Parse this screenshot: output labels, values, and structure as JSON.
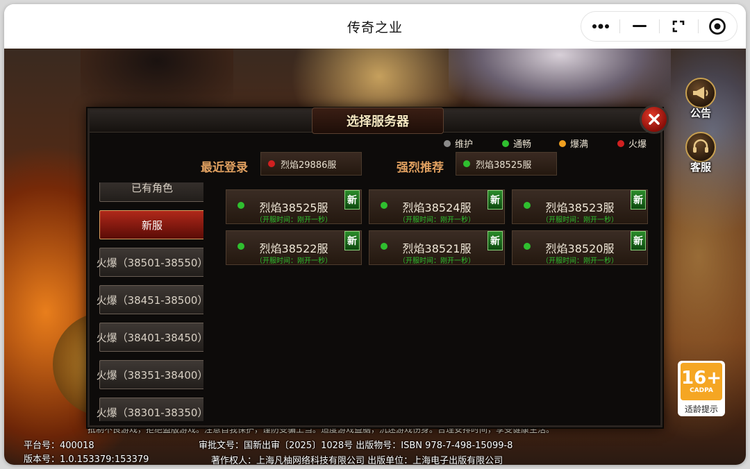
{
  "window": {
    "title": "传奇之业"
  },
  "capsule": {
    "more": "more-icon",
    "minimize": "minimize-icon",
    "fullscreen": "fullscreen-icon",
    "close": "close-circle-icon"
  },
  "side_buttons": {
    "notice": "公告",
    "service": "客服"
  },
  "age_rating": {
    "age": "16+",
    "org": "CADPA",
    "tip": "适龄提示"
  },
  "dialog": {
    "title": "选择服务器",
    "legend": [
      {
        "label": "维护",
        "color": "#8a8a8a"
      },
      {
        "label": "通畅",
        "color": "#2fbf2f"
      },
      {
        "label": "爆满",
        "color": "#f0a020"
      },
      {
        "label": "火爆",
        "color": "#d02020"
      }
    ],
    "recent_label": "最近登录",
    "recent_server": "烈焰29886服",
    "recommend_label": "强烈推荐",
    "recommend_server": "烈焰38525服",
    "categories": [
      "已有角色",
      "新服",
      "火爆（38501-38550）",
      "火爆（38451-38500）",
      "火爆（38401-38450）",
      "火爆（38351-38400）",
      "火爆（38301-38350）"
    ],
    "active_category": "新服",
    "new_tag": "新",
    "servers": [
      {
        "name": "烈焰38525服",
        "sub": "（开服时间：刚开一秒）"
      },
      {
        "name": "烈焰38524服",
        "sub": "（开服时间：刚开一秒）"
      },
      {
        "name": "烈焰38523服",
        "sub": "（开服时间：刚开一秒）"
      },
      {
        "name": "烈焰38522服",
        "sub": "（开服时间：刚开一秒）"
      },
      {
        "name": "烈焰38521服",
        "sub": "（开服时间：刚开一秒）"
      },
      {
        "name": "烈焰38520服",
        "sub": "（开服时间：刚开一秒）"
      }
    ]
  },
  "footer": {
    "health_notice": "抵制不良游戏，拒绝盗版游戏。注意自我保护，谨防受骗上当。适度游戏益脑，沉迷游戏伤身。合理安排时间，享受健康生活。",
    "platform_no": "平台号：400018",
    "version_no": "版本号：1.0.153379:153379",
    "approval": "审批文号：国新出审〔2025〕1028号 出版物号：ISBN 978-7-498-15099-8",
    "copyright": "著作权人：上海凡柚网络科技有限公司 出版单位：上海电子出版有限公司"
  }
}
